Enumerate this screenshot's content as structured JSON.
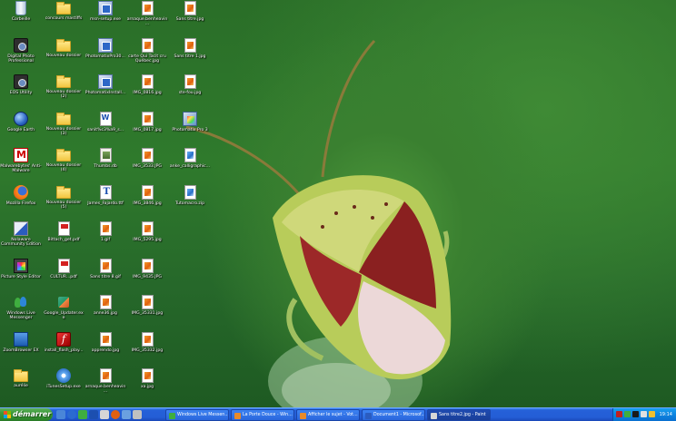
{
  "desktop": {
    "icons": [
      {
        "label": "Corbeille",
        "type": "trash"
      },
      {
        "label": "Digital Photo Professional",
        "type": "camera"
      },
      {
        "label": "EOS Utility",
        "type": "camera"
      },
      {
        "label": "Google Earth",
        "type": "globe"
      },
      {
        "label": "Malwarebytes' Anti-Malware",
        "type": "malware"
      },
      {
        "label": "Mozilla Firefox",
        "type": "firefox"
      },
      {
        "label": "Nolaware Community Edition",
        "type": "nolo"
      },
      {
        "label": "Picture Style Editor",
        "type": "ps"
      },
      {
        "label": "Windows Live Messenger",
        "type": "msn"
      },
      {
        "label": "ZoomBrowser EX",
        "type": "zoom"
      },
      {
        "label": "aurélie",
        "type": "folder"
      },
      {
        "label": "concours mastiffs",
        "type": "folder"
      },
      {
        "label": "Nouveau dossier",
        "type": "folder"
      },
      {
        "label": "Nouveau dossier (2)",
        "type": "folder"
      },
      {
        "label": "Nouveau dossier (3)",
        "type": "folder"
      },
      {
        "label": "Nouveau dossier (4)",
        "type": "folder"
      },
      {
        "label": "Nouveau dossier (5)",
        "type": "folder"
      },
      {
        "label": "Bittach_get.pdf",
        "type": "pdf"
      },
      {
        "label": "CULTUR...pdf",
        "type": "pdf"
      },
      {
        "label": "Google_Updater.exe",
        "type": "google-upd"
      },
      {
        "label": "install_flash_play...",
        "type": "flash"
      },
      {
        "label": "iTunesSetup.exe",
        "type": "itunes"
      },
      {
        "label": "msn-setup.exe",
        "type": "exe"
      },
      {
        "label": "PhotomatixPro30...",
        "type": "exe"
      },
      {
        "label": "PhotomatixInstall...",
        "type": "exe"
      },
      {
        "label": "sanit%c3%a9_s...",
        "type": "doc"
      },
      {
        "label": "Thumbs.db",
        "type": "db"
      },
      {
        "label": "James_Fajardo.ttf",
        "type": "font"
      },
      {
        "label": "1.gif",
        "type": "jpg"
      },
      {
        "label": "Sans titre 8.gif",
        "type": "jpg"
      },
      {
        "label": "anne36.jpg",
        "type": "jpg"
      },
      {
        "label": "apprendo.jpg",
        "type": "jpg"
      },
      {
        "label": "arnaque.benheavin...",
        "type": "jpg"
      },
      {
        "label": "arnaque.benheavin...",
        "type": "jpg"
      },
      {
        "label": "carte Qui Tacit cru Québec.jpg",
        "type": "jpg"
      },
      {
        "label": "IMG_0816.jpg",
        "type": "jpg"
      },
      {
        "label": "IMG_0817.jpg",
        "type": "jpg"
      },
      {
        "label": "IMG_3533.JPG",
        "type": "jpg"
      },
      {
        "label": "IMG_3846.jpg",
        "type": "jpg"
      },
      {
        "label": "IMG_5295.jpg",
        "type": "jpg"
      },
      {
        "label": "IMG_9435.JPG",
        "type": "jpg"
      },
      {
        "label": "IMG_35331.jpg",
        "type": "jpg"
      },
      {
        "label": "IMG_35332.jpg",
        "type": "jpg"
      },
      {
        "label": "xa.jpg",
        "type": "jpg"
      },
      {
        "label": "Sans titre.jpg",
        "type": "jpg"
      },
      {
        "label": "Sans titre 1.jpg",
        "type": "jpg"
      },
      {
        "label": "ste-fou.jpg",
        "type": "jpg"
      },
      {
        "label": "Photomatix Pro 3",
        "type": "pmx"
      },
      {
        "label": "anke_calligraphic...",
        "type": "jpg-blue"
      },
      {
        "label": "Tutomacro.zip",
        "type": "jpg-blue"
      }
    ]
  },
  "taskbar": {
    "start_label": "démarrer",
    "tasks": [
      {
        "label": "Windows Live Messen...",
        "color": "#3fae3f"
      },
      {
        "label": "La Porte Douce - Win...",
        "color": "#e88a2a"
      },
      {
        "label": "Afficher le sujet - Vot...",
        "color": "#e88a2a"
      },
      {
        "label": "Document1 - Microsof...",
        "color": "#2b5cc0"
      },
      {
        "label": "Sans titre2.jpg - Paint",
        "color": "#d6d6d6"
      }
    ],
    "clock": "19:14"
  }
}
